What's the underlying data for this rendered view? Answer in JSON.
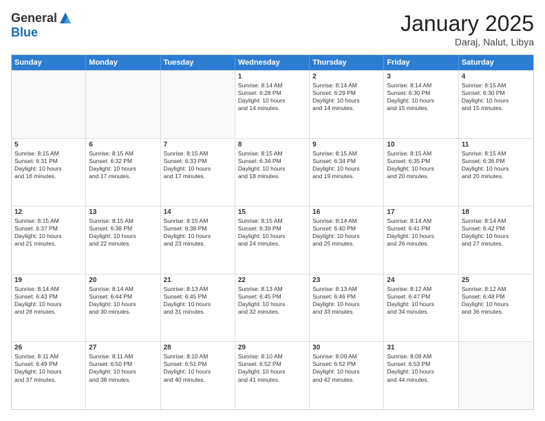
{
  "logo": {
    "general": "General",
    "blue": "Blue"
  },
  "title": "January 2025",
  "subtitle": "Daraj, Nalut, Libya",
  "weekdays": [
    "Sunday",
    "Monday",
    "Tuesday",
    "Wednesday",
    "Thursday",
    "Friday",
    "Saturday"
  ],
  "rows": [
    [
      {
        "day": "",
        "lines": [],
        "empty": true
      },
      {
        "day": "",
        "lines": [],
        "empty": true
      },
      {
        "day": "",
        "lines": [],
        "empty": true
      },
      {
        "day": "1",
        "lines": [
          "Sunrise: 8:14 AM",
          "Sunset: 6:28 PM",
          "Daylight: 10 hours",
          "and 14 minutes."
        ],
        "empty": false
      },
      {
        "day": "2",
        "lines": [
          "Sunrise: 8:14 AM",
          "Sunset: 6:29 PM",
          "Daylight: 10 hours",
          "and 14 minutes."
        ],
        "empty": false
      },
      {
        "day": "3",
        "lines": [
          "Sunrise: 8:14 AM",
          "Sunset: 6:30 PM",
          "Daylight: 10 hours",
          "and 15 minutes."
        ],
        "empty": false
      },
      {
        "day": "4",
        "lines": [
          "Sunrise: 8:15 AM",
          "Sunset: 6:30 PM",
          "Daylight: 10 hours",
          "and 15 minutes."
        ],
        "empty": false
      }
    ],
    [
      {
        "day": "5",
        "lines": [
          "Sunrise: 8:15 AM",
          "Sunset: 6:31 PM",
          "Daylight: 10 hours",
          "and 16 minutes."
        ],
        "empty": false
      },
      {
        "day": "6",
        "lines": [
          "Sunrise: 8:15 AM",
          "Sunset: 6:32 PM",
          "Daylight: 10 hours",
          "and 17 minutes."
        ],
        "empty": false
      },
      {
        "day": "7",
        "lines": [
          "Sunrise: 8:15 AM",
          "Sunset: 6:33 PM",
          "Daylight: 10 hours",
          "and 17 minutes."
        ],
        "empty": false
      },
      {
        "day": "8",
        "lines": [
          "Sunrise: 8:15 AM",
          "Sunset: 6:34 PM",
          "Daylight: 10 hours",
          "and 18 minutes."
        ],
        "empty": false
      },
      {
        "day": "9",
        "lines": [
          "Sunrise: 8:15 AM",
          "Sunset: 6:34 PM",
          "Daylight: 10 hours",
          "and 19 minutes."
        ],
        "empty": false
      },
      {
        "day": "10",
        "lines": [
          "Sunrise: 8:15 AM",
          "Sunset: 6:35 PM",
          "Daylight: 10 hours",
          "and 20 minutes."
        ],
        "empty": false
      },
      {
        "day": "11",
        "lines": [
          "Sunrise: 8:15 AM",
          "Sunset: 6:36 PM",
          "Daylight: 10 hours",
          "and 20 minutes."
        ],
        "empty": false
      }
    ],
    [
      {
        "day": "12",
        "lines": [
          "Sunrise: 8:15 AM",
          "Sunset: 6:37 PM",
          "Daylight: 10 hours",
          "and 21 minutes."
        ],
        "empty": false
      },
      {
        "day": "13",
        "lines": [
          "Sunrise: 8:15 AM",
          "Sunset: 6:38 PM",
          "Daylight: 10 hours",
          "and 22 minutes."
        ],
        "empty": false
      },
      {
        "day": "14",
        "lines": [
          "Sunrise: 8:15 AM",
          "Sunset: 6:38 PM",
          "Daylight: 10 hours",
          "and 23 minutes."
        ],
        "empty": false
      },
      {
        "day": "15",
        "lines": [
          "Sunrise: 8:15 AM",
          "Sunset: 6:39 PM",
          "Daylight: 10 hours",
          "and 24 minutes."
        ],
        "empty": false
      },
      {
        "day": "16",
        "lines": [
          "Sunrise: 8:14 AM",
          "Sunset: 6:40 PM",
          "Daylight: 10 hours",
          "and 25 minutes."
        ],
        "empty": false
      },
      {
        "day": "17",
        "lines": [
          "Sunrise: 8:14 AM",
          "Sunset: 6:41 PM",
          "Daylight: 10 hours",
          "and 26 minutes."
        ],
        "empty": false
      },
      {
        "day": "18",
        "lines": [
          "Sunrise: 8:14 AM",
          "Sunset: 6:42 PM",
          "Daylight: 10 hours",
          "and 27 minutes."
        ],
        "empty": false
      }
    ],
    [
      {
        "day": "19",
        "lines": [
          "Sunrise: 8:14 AM",
          "Sunset: 6:43 PM",
          "Daylight: 10 hours",
          "and 28 minutes."
        ],
        "empty": false
      },
      {
        "day": "20",
        "lines": [
          "Sunrise: 8:14 AM",
          "Sunset: 6:44 PM",
          "Daylight: 10 hours",
          "and 30 minutes."
        ],
        "empty": false
      },
      {
        "day": "21",
        "lines": [
          "Sunrise: 8:13 AM",
          "Sunset: 6:45 PM",
          "Daylight: 10 hours",
          "and 31 minutes."
        ],
        "empty": false
      },
      {
        "day": "22",
        "lines": [
          "Sunrise: 8:13 AM",
          "Sunset: 6:45 PM",
          "Daylight: 10 hours",
          "and 32 minutes."
        ],
        "empty": false
      },
      {
        "day": "23",
        "lines": [
          "Sunrise: 8:13 AM",
          "Sunset: 6:46 PM",
          "Daylight: 10 hours",
          "and 33 minutes."
        ],
        "empty": false
      },
      {
        "day": "24",
        "lines": [
          "Sunrise: 8:12 AM",
          "Sunset: 6:47 PM",
          "Daylight: 10 hours",
          "and 34 minutes."
        ],
        "empty": false
      },
      {
        "day": "25",
        "lines": [
          "Sunrise: 8:12 AM",
          "Sunset: 6:48 PM",
          "Daylight: 10 hours",
          "and 36 minutes."
        ],
        "empty": false
      }
    ],
    [
      {
        "day": "26",
        "lines": [
          "Sunrise: 8:11 AM",
          "Sunset: 6:49 PM",
          "Daylight: 10 hours",
          "and 37 minutes."
        ],
        "empty": false
      },
      {
        "day": "27",
        "lines": [
          "Sunrise: 8:11 AM",
          "Sunset: 6:50 PM",
          "Daylight: 10 hours",
          "and 38 minutes."
        ],
        "empty": false
      },
      {
        "day": "28",
        "lines": [
          "Sunrise: 8:10 AM",
          "Sunset: 6:51 PM",
          "Daylight: 10 hours",
          "and 40 minutes."
        ],
        "empty": false
      },
      {
        "day": "29",
        "lines": [
          "Sunrise: 8:10 AM",
          "Sunset: 6:52 PM",
          "Daylight: 10 hours",
          "and 41 minutes."
        ],
        "empty": false
      },
      {
        "day": "30",
        "lines": [
          "Sunrise: 8:09 AM",
          "Sunset: 6:52 PM",
          "Daylight: 10 hours",
          "and 42 minutes."
        ],
        "empty": false
      },
      {
        "day": "31",
        "lines": [
          "Sunrise: 8:09 AM",
          "Sunset: 6:53 PM",
          "Daylight: 10 hours",
          "and 44 minutes."
        ],
        "empty": false
      },
      {
        "day": "",
        "lines": [],
        "empty": true
      }
    ]
  ]
}
